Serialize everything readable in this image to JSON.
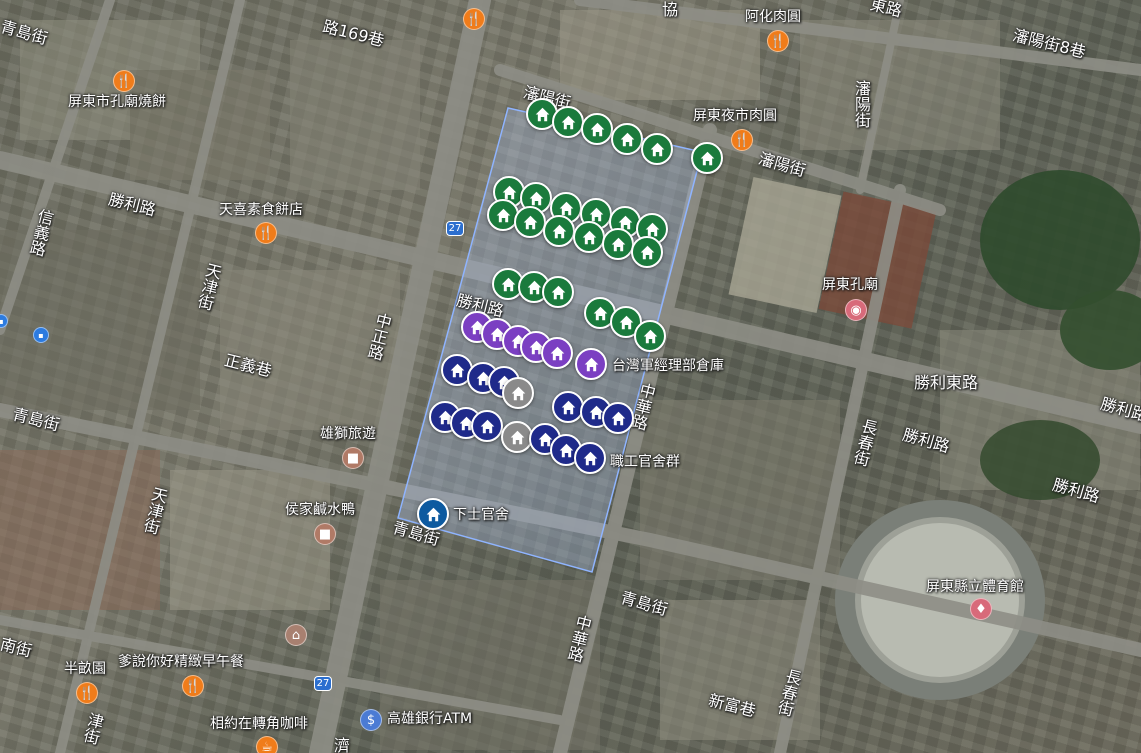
{
  "map": {
    "streets": [
      {
        "id": "street-shengli-rd-1",
        "label": "勝利路"
      },
      {
        "id": "street-shengli-rd-2",
        "label": "勝利路"
      },
      {
        "id": "street-shengli-rd-3",
        "label": "勝利路"
      },
      {
        "id": "street-shengli-rd-4",
        "label": "勝利路"
      },
      {
        "id": "street-shengli-rd-5",
        "label": "勝利路"
      },
      {
        "id": "street-shengli-east-rd",
        "label": "勝利東路"
      },
      {
        "id": "street-zhongzheng-rd",
        "label": "中正路"
      },
      {
        "id": "street-zhonghua-rd-1",
        "label": "中華路"
      },
      {
        "id": "street-zhonghua-rd-2",
        "label": "中華路"
      },
      {
        "id": "street-qingdao-st-1",
        "label": "青島街"
      },
      {
        "id": "street-qingdao-st-2",
        "label": "青島街"
      },
      {
        "id": "street-qingdao-st-3",
        "label": "青島街"
      },
      {
        "id": "street-tianjin-st-1",
        "label": "天津街"
      },
      {
        "id": "street-tianjin-st-2",
        "label": "天津街"
      },
      {
        "id": "street-tianjin-st-3",
        "label": "津街"
      },
      {
        "id": "street-zhengyi-lane",
        "label": "正義巷"
      },
      {
        "id": "street-xinyi-rd",
        "label": "信義路"
      },
      {
        "id": "street-lane-169",
        "label": "路169巷"
      },
      {
        "id": "street-pan-yang-st-1",
        "label": "瀋陽街"
      },
      {
        "id": "street-pan-yang-st-2",
        "label": "瀋陽街"
      },
      {
        "id": "street-pan-yang-st-3",
        "label": "瀋陽街"
      },
      {
        "id": "street-pan-yang-lane-8",
        "label": "瀋陽街8巷"
      },
      {
        "id": "street-changchun-st-1",
        "label": "長春街"
      },
      {
        "id": "street-changchun-st-2",
        "label": "長春街"
      },
      {
        "id": "street-changchun-st-3",
        "label": "長春街"
      },
      {
        "id": "street-xinfu-lane",
        "label": "新富巷"
      },
      {
        "id": "street-nan-st",
        "label": "南街"
      },
      {
        "id": "street-ji",
        "label": "濟"
      },
      {
        "id": "street-xie",
        "label": "協"
      },
      {
        "id": "street-jie-top",
        "label": "東路"
      }
    ],
    "pois": [
      {
        "id": "poi-confucius-temple-bakery",
        "label": "屏東市孔廟燒餅",
        "icon": "restaurant-icon"
      },
      {
        "id": "poi-tianxi-vegetarian",
        "label": "天喜素食餅店",
        "icon": "restaurant-icon"
      },
      {
        "id": "poi-ahua-meat",
        "label": "阿化肉圓",
        "icon": "restaurant-icon"
      },
      {
        "id": "poi-night-market-meat",
        "label": "屏東夜市肉圓",
        "icon": "restaurant-icon"
      },
      {
        "id": "poi-confucius-temple",
        "label": "屏東孔廟",
        "icon": "camera-icon"
      },
      {
        "id": "poi-xiongshi-travel",
        "label": "雄獅旅遊",
        "icon": "shop-icon"
      },
      {
        "id": "poi-hou-family-duck",
        "label": "侯家鹹水鴨",
        "icon": "shop-icon"
      },
      {
        "id": "poi-stadium",
        "label": "屏東縣立體育館",
        "icon": "stadium-icon"
      },
      {
        "id": "poi-banmu-garden",
        "label": "半畝園",
        "icon": "restaurant-icon"
      },
      {
        "id": "poi-breakfast",
        "label": "爹說你好精緻早午餐",
        "icon": "restaurant-icon"
      },
      {
        "id": "poi-corner-cafe",
        "label": "相約在轉角咖啡",
        "icon": "cafe-icon"
      },
      {
        "id": "poi-kaohsiung-bank-atm",
        "label": "高雄銀行ATM",
        "icon": "atm-icon"
      },
      {
        "id": "poi-museum",
        "label": "",
        "icon": "museum-icon"
      },
      {
        "id": "poi-restaurant-top",
        "label": "",
        "icon": "restaurant-icon"
      }
    ],
    "route_shields": [
      {
        "id": "route-27-top",
        "label": "27"
      },
      {
        "id": "route-27-bottom",
        "label": "27"
      }
    ],
    "marker_labels": {
      "warehouse": "台灣軍經理部倉庫",
      "staff_dorms": "職工官舍群",
      "nco_dorm": "下士官舍"
    },
    "marker_colors": {
      "green": "#1a7a3c",
      "purple": "#7b3fc2",
      "navy": "#1f2a8a",
      "gray": "#8a8a8a",
      "blue": "#0d5aa0"
    },
    "selection_rectangle": {
      "stroke": "#8fb4ff",
      "fill": "rgba(170,190,230,0.35)"
    }
  }
}
